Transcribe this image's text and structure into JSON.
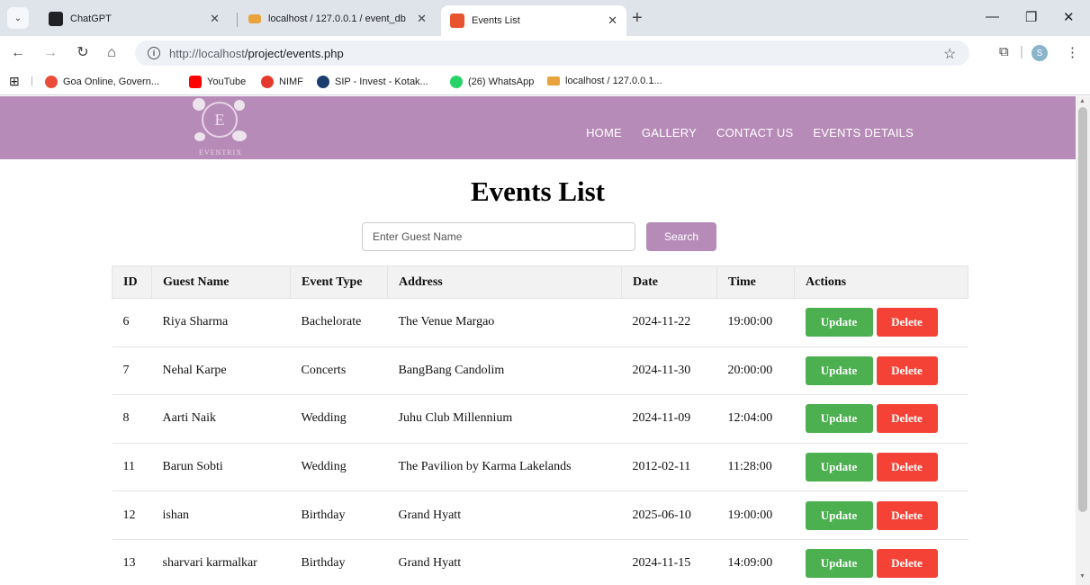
{
  "browser": {
    "tabs": [
      {
        "title": "ChatGPT",
        "active": false,
        "fav_color": "#202124"
      },
      {
        "title": "localhost / 127.0.0.1 / event_db",
        "active": false,
        "fav_color": "#e8a33d"
      },
      {
        "title": "Events List",
        "active": true,
        "fav_color": "#e8542f"
      }
    ],
    "url_host": "http://localhost",
    "url_path": "/project/events.php",
    "profile_initial": "S",
    "bookmarks": [
      {
        "label": "Goa Online, Govern...",
        "color": "#e94d3a"
      },
      {
        "label": "YouTube",
        "color": "#ff0000"
      },
      {
        "label": "NIMF",
        "color": "#e5392e"
      },
      {
        "label": "SIP - Invest - Kotak...",
        "color": "#1d3c6e"
      },
      {
        "label": "(26) WhatsApp",
        "color": "#25d366"
      },
      {
        "label": "localhost / 127.0.0.1...",
        "color": "#e8a33d"
      }
    ]
  },
  "site": {
    "brand": "EVENTRIX",
    "logo_letter": "E",
    "nav": [
      "HOME",
      "GALLERY",
      "CONTACT US",
      "EVENTS DETAILS"
    ],
    "header_color": "#b78bb8"
  },
  "main": {
    "title": "Events List",
    "search_placeholder": "Enter Guest Name",
    "search_label": "Search",
    "columns": [
      "ID",
      "Guest Name",
      "Event Type",
      "Address",
      "Date",
      "Time",
      "Actions"
    ],
    "rows": [
      [
        "6",
        "Riya Sharma",
        "Bachelorate",
        "The Venue Margao",
        "2024-11-22",
        "19:00:00"
      ],
      [
        "7",
        "Nehal Karpe",
        "Concerts",
        "BangBang Candolim",
        "2024-11-30",
        "20:00:00"
      ],
      [
        "8",
        "Aarti Naik",
        "Wedding",
        "Juhu Club Millennium",
        "2024-11-09",
        "12:04:00"
      ],
      [
        "11",
        "Barun Sobti",
        "Wedding",
        "The Pavilion by Karma Lakelands",
        "2012-02-11",
        "11:28:00"
      ],
      [
        "12",
        "ishan",
        "Birthday",
        "Grand Hyatt",
        "2025-06-10",
        "19:00:00"
      ],
      [
        "13",
        "sharvari karmalkar",
        "Birthday",
        "Grand Hyatt",
        "2024-11-15",
        "14:09:00"
      ]
    ],
    "update_label": "Update",
    "delete_label": "Delete"
  }
}
